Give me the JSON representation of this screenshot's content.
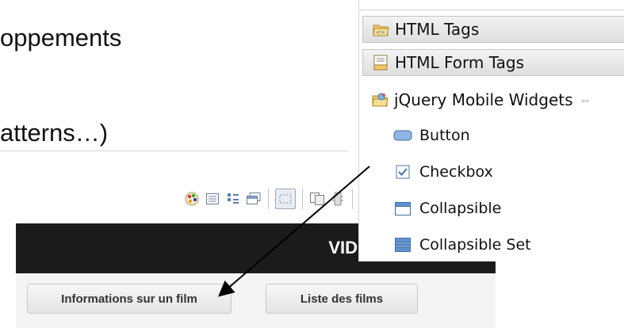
{
  "slide": {
    "line1": "oppements",
    "line2": "atterns…)"
  },
  "app_header": {
    "title": "VID"
  },
  "nav": {
    "buttons": [
      {
        "label": "Informations sur un film"
      },
      {
        "label": "Liste des films"
      }
    ]
  },
  "palette": {
    "categories": [
      {
        "label": "HTML Tags",
        "icon": "html-tags-icon"
      },
      {
        "label": "HTML Form Tags",
        "icon": "html-form-tags-icon"
      },
      {
        "label": "jQuery Mobile Widgets",
        "icon": "jquery-mobile-widgets-icon",
        "expanded": true
      }
    ],
    "items": [
      {
        "label": "Button",
        "icon": "button-widget-icon"
      },
      {
        "label": "Checkbox",
        "icon": "checkbox-widget-icon"
      },
      {
        "label": "Collapsible",
        "icon": "collapsible-widget-icon"
      },
      {
        "label": "Collapsible Set",
        "icon": "collapsible-set-widget-icon"
      }
    ]
  },
  "toolbar": {
    "icons": [
      "palette-icon",
      "list-icon",
      "tree-icon",
      "stack-icon",
      "selection-icon",
      "copy-icon",
      "device-icon",
      "split-horizontal-icon",
      "split-vertical-icon"
    ]
  },
  "colors": {
    "header_bg": "#1b1b1b",
    "nav_bg": "#f4f4f4",
    "arrow": "#000000"
  }
}
